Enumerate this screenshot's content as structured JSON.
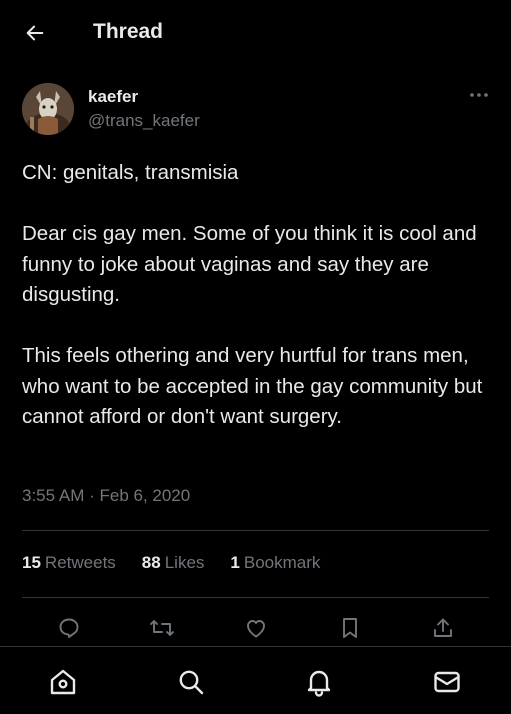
{
  "header": {
    "title": "Thread",
    "back_icon": "arrow-left-icon"
  },
  "tweet": {
    "author": {
      "display_name": "kaefer",
      "handle": "@trans_kaefer",
      "avatar": "avatar-image"
    },
    "paragraphs": [
      "CN: genitals, transmisia",
      "Dear cis gay men. Some of you think it is cool and funny to joke about vaginas and say they are disgusting.",
      "This feels othering and very hurtful for trans men, who want to be accepted in the gay community but cannot afford or don't want surgery."
    ],
    "timestamp": "3:55 AM · Feb 6, 2020",
    "stats": {
      "retweets_count": "15",
      "retweets_label": "Retweets",
      "likes_count": "88",
      "likes_label": "Likes",
      "bookmarks_count": "1",
      "bookmarks_label": "Bookmark"
    }
  },
  "actions": [
    "reply-icon",
    "retweet-icon",
    "like-icon",
    "bookmark-icon",
    "share-icon"
  ],
  "bottom_nav": [
    "home-icon",
    "search-icon",
    "notifications-icon",
    "messages-icon"
  ],
  "colors": {
    "background": "#000000",
    "text_primary": "#e7e9ea",
    "text_secondary": "#71767b",
    "divider": "#2f3336"
  }
}
